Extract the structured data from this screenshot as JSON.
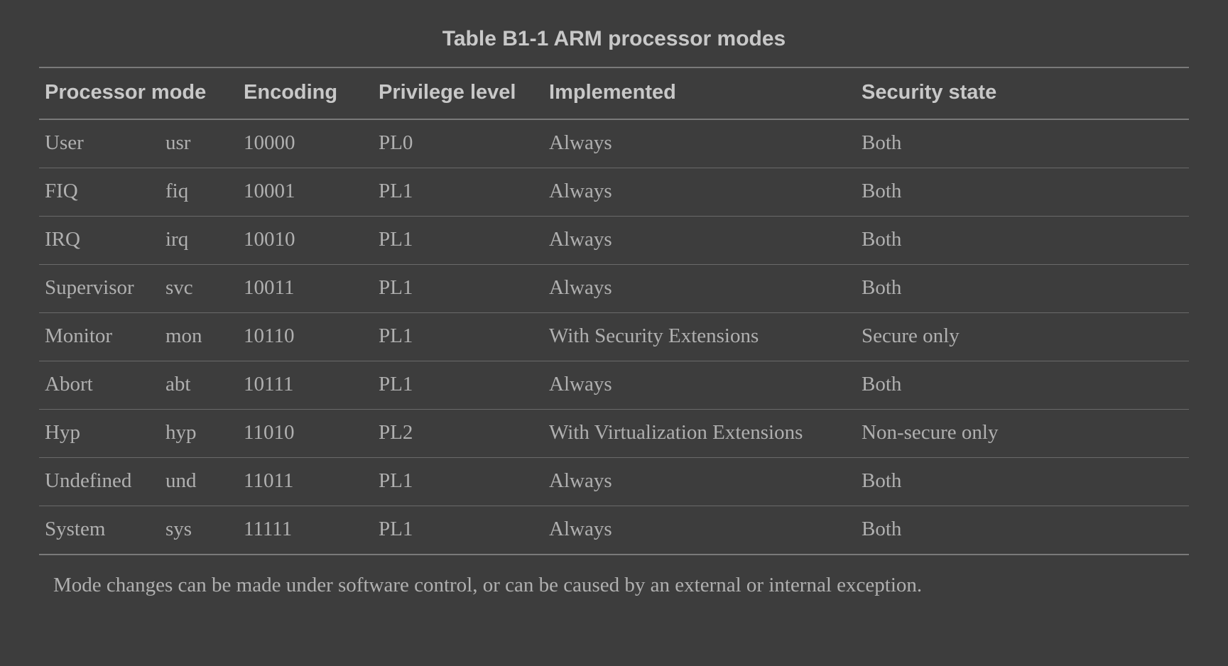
{
  "caption": "Table B1-1 ARM processor modes",
  "headers": {
    "mode": "Processor mode",
    "encoding": "Encoding",
    "privilege": "Privilege level",
    "implemented": "Implemented",
    "security": "Security state"
  },
  "rows": [
    {
      "name": "User",
      "abbr": "usr",
      "encoding": "10000",
      "privilege": "PL0",
      "implemented": "Always",
      "security": "Both"
    },
    {
      "name": "FIQ",
      "abbr": "fiq",
      "encoding": "10001",
      "privilege": "PL1",
      "implemented": "Always",
      "security": "Both"
    },
    {
      "name": "IRQ",
      "abbr": "irq",
      "encoding": "10010",
      "privilege": "PL1",
      "implemented": "Always",
      "security": "Both"
    },
    {
      "name": "Supervisor",
      "abbr": "svc",
      "encoding": "10011",
      "privilege": "PL1",
      "implemented": "Always",
      "security": "Both"
    },
    {
      "name": "Monitor",
      "abbr": "mon",
      "encoding": "10110",
      "privilege": "PL1",
      "implemented": "With Security Extensions",
      "security": "Secure only"
    },
    {
      "name": "Abort",
      "abbr": "abt",
      "encoding": "10111",
      "privilege": "PL1",
      "implemented": "Always",
      "security": "Both"
    },
    {
      "name": "Hyp",
      "abbr": "hyp",
      "encoding": "11010",
      "privilege": "PL2",
      "implemented": "With Virtualization Extensions",
      "security": "Non-secure only"
    },
    {
      "name": "Undefined",
      "abbr": "und",
      "encoding": "11011",
      "privilege": "PL1",
      "implemented": "Always",
      "security": "Both"
    },
    {
      "name": "System",
      "abbr": "sys",
      "encoding": "11111",
      "privilege": "PL1",
      "implemented": "Always",
      "security": "Both"
    }
  ],
  "footnote": "Mode changes can be made under software control, or can be caused by an external or internal exception."
}
